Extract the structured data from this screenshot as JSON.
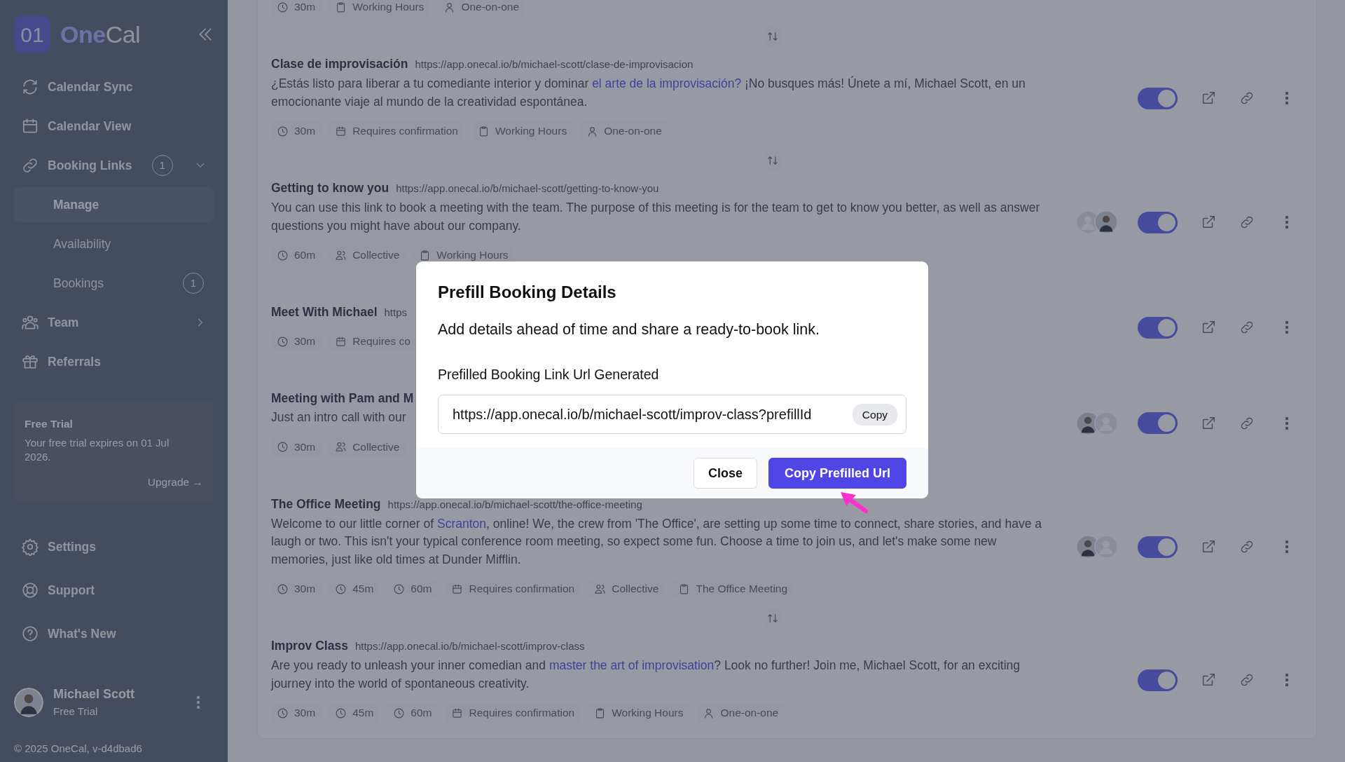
{
  "sidebar": {
    "logo_mark": "01",
    "brand_parts": [
      "One",
      "Cal"
    ],
    "nav": [
      {
        "label": "Calendar Sync"
      },
      {
        "label": "Calendar View"
      },
      {
        "label": "Booking Links",
        "badge": "1",
        "expanded": true,
        "children": [
          {
            "label": "Manage",
            "selected": true
          },
          {
            "label": "Availability",
            "selected": false
          },
          {
            "label": "Bookings",
            "selected": false,
            "badge": "1"
          }
        ]
      },
      {
        "label": "Team",
        "expanded": false
      },
      {
        "label": "Referrals"
      }
    ],
    "trial": {
      "title": "Free Trial",
      "text": "Your free trial expires on 01 Jul 2026.",
      "action": "Upgrade →"
    },
    "bottom_nav": [
      {
        "label": "Settings"
      },
      {
        "label": "Support"
      },
      {
        "label": "What's New"
      }
    ],
    "user": {
      "name": "Michael Scott",
      "plan": "Free Trial"
    },
    "footer": "© 2025 OneCal, v-d4dbad6"
  },
  "booking_links": [
    {
      "tags": [
        {
          "kind": "duration",
          "text": "30m"
        },
        {
          "kind": "schedule",
          "text": "Working Hours"
        },
        {
          "kind": "person",
          "text": "One-on-one"
        }
      ]
    },
    {
      "title": "Clase de improvisación",
      "url": "https://app.onecal.io/b/michael-scott/clase-de-improvisacion",
      "description": [
        {
          "kind": "text",
          "text": "¿Estás listo para liberar a tu comediante interior y dominar "
        },
        {
          "kind": "link",
          "text": "el arte de la improvisación?"
        },
        {
          "kind": "text",
          "text": " ¡No busques más! Únete a mí, Michael Scott, en un emocionante viaje al mundo de la creatividad espontánea."
        }
      ],
      "tags": [
        {
          "kind": "duration",
          "text": "30m"
        },
        {
          "kind": "confirmation",
          "text": "Requires confirmation"
        },
        {
          "kind": "schedule",
          "text": "Working Hours"
        },
        {
          "kind": "person",
          "text": "One-on-one"
        }
      ],
      "on": true
    },
    {
      "title": "Getting to know you",
      "url": "https://app.onecal.io/b/michael-scott/getting-to-know-you",
      "description": [
        {
          "kind": "text",
          "text": "You can use this link to book a meeting with the team. The purpose of this meeting is for the team to get to know you better, as well as answer questions you might have about our company."
        }
      ],
      "tags": [
        {
          "kind": "duration",
          "text": "60m"
        },
        {
          "kind": "group",
          "text": "Collective"
        },
        {
          "kind": "schedule",
          "text": "Working Hours"
        }
      ],
      "avatars": [
        {
          "kind": "placeholder"
        },
        {
          "kind": "photo"
        }
      ],
      "on": true
    },
    {
      "title": "Meet With Michael",
      "url": "https",
      "tags": [
        {
          "kind": "duration",
          "text": "30m"
        },
        {
          "kind": "confirmation",
          "text": "Requires co"
        }
      ],
      "on": true
    },
    {
      "title": "Meeting with Pam and M",
      "description": [
        {
          "kind": "text",
          "text": "Just an intro call with our"
        }
      ],
      "tags": [
        {
          "kind": "duration",
          "text": "30m"
        },
        {
          "kind": "group",
          "text": "Collective"
        }
      ],
      "avatars": [
        {
          "kind": "photo"
        },
        {
          "kind": "placeholder"
        }
      ],
      "on": true
    },
    {
      "title": "The Office Meeting",
      "url": "https://app.onecal.io/b/michael-scott/the-office-meeting",
      "description": [
        {
          "kind": "text",
          "text": "Welcome to our little corner of "
        },
        {
          "kind": "link",
          "text": "Scranton"
        },
        {
          "kind": "text",
          "text": ", online! We, the crew from 'The Office', are setting up some time to connect, share stories, and have a laugh or two. This isn't your typical conference room meeting, so expect some fun. Choose a time to join us, and let's make some new memories, just like old times at Dunder Mifflin."
        }
      ],
      "tags": [
        {
          "kind": "duration",
          "text": "30m"
        },
        {
          "kind": "duration",
          "text": "45m"
        },
        {
          "kind": "duration",
          "text": "60m"
        },
        {
          "kind": "confirmation",
          "text": "Requires confirmation"
        },
        {
          "kind": "group",
          "text": "Collective"
        },
        {
          "kind": "schedule",
          "text": "The Office Meeting"
        }
      ],
      "avatars": [
        {
          "kind": "photo"
        },
        {
          "kind": "placeholder"
        }
      ],
      "on": true
    },
    {
      "title": "Improv Class",
      "url": "https://app.onecal.io/b/michael-scott/improv-class",
      "description": [
        {
          "kind": "text",
          "text": "Are you ready to unleash your inner comedian and "
        },
        {
          "kind": "link",
          "text": "master the art of improvisation"
        },
        {
          "kind": "text",
          "text": "? Look no further! Join me, Michael Scott, for an exciting journey into the world of spontaneous creativity."
        }
      ],
      "tags": [
        {
          "kind": "duration",
          "text": "30m"
        },
        {
          "kind": "duration",
          "text": "45m"
        },
        {
          "kind": "duration",
          "text": "60m"
        },
        {
          "kind": "confirmation",
          "text": "Requires confirmation"
        },
        {
          "kind": "schedule",
          "text": "Working Hours"
        },
        {
          "kind": "person",
          "text": "One-on-one"
        }
      ],
      "on": true
    }
  ],
  "modal": {
    "title": "Prefill Booking Details",
    "subtitle": "Add details ahead of time and share a ready-to-book link.",
    "field_label": "Prefilled Booking Link Url Generated",
    "url": "https://app.onecal.io/b/michael-scott/improv-class?prefillId",
    "copy_button": "Copy",
    "buttons": [
      {
        "label": "Close",
        "kind": "secondary"
      },
      {
        "label": "Copy Prefilled Url",
        "kind": "primary"
      }
    ]
  }
}
